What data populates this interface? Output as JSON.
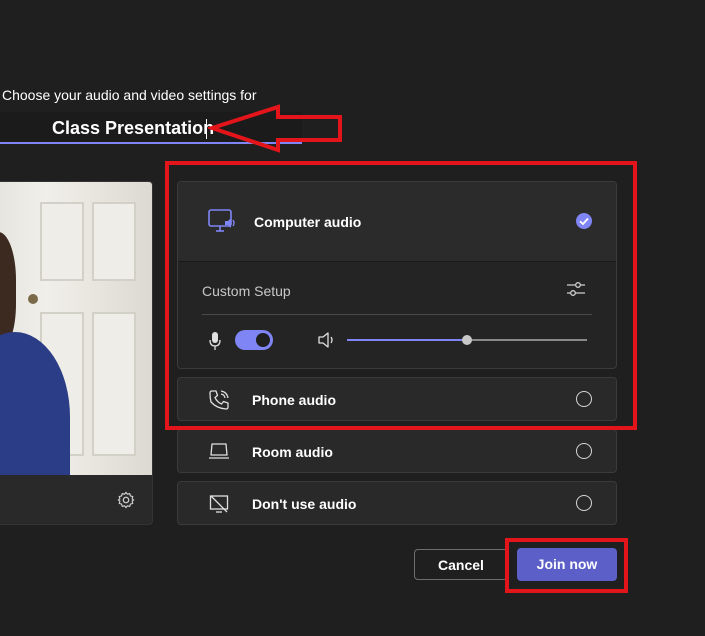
{
  "prejoin": {
    "subtitle": "Choose your audio and video settings for",
    "meeting_name": "Class Presentation"
  },
  "video": {
    "settings_icon": "gear-icon"
  },
  "audio_options": {
    "computer": {
      "label": "Computer audio",
      "icon": "computer-speaker-icon",
      "selected": true,
      "custom_setup_label": "Custom Setup",
      "mic_on": true,
      "volume_level_percent": 50
    },
    "phone": {
      "label": "Phone audio",
      "icon": "phone-icon",
      "selected": false
    },
    "room": {
      "label": "Room audio",
      "icon": "room-device-icon",
      "selected": false
    },
    "none": {
      "label": "Don't use audio",
      "icon": "no-audio-icon",
      "selected": false
    }
  },
  "actions": {
    "cancel_label": "Cancel",
    "join_label": "Join now"
  },
  "colors": {
    "accent": "#7f85f5",
    "primary_button": "#5b5fc7",
    "annotation_red": "#e3151a",
    "background": "#1f1f1f"
  }
}
